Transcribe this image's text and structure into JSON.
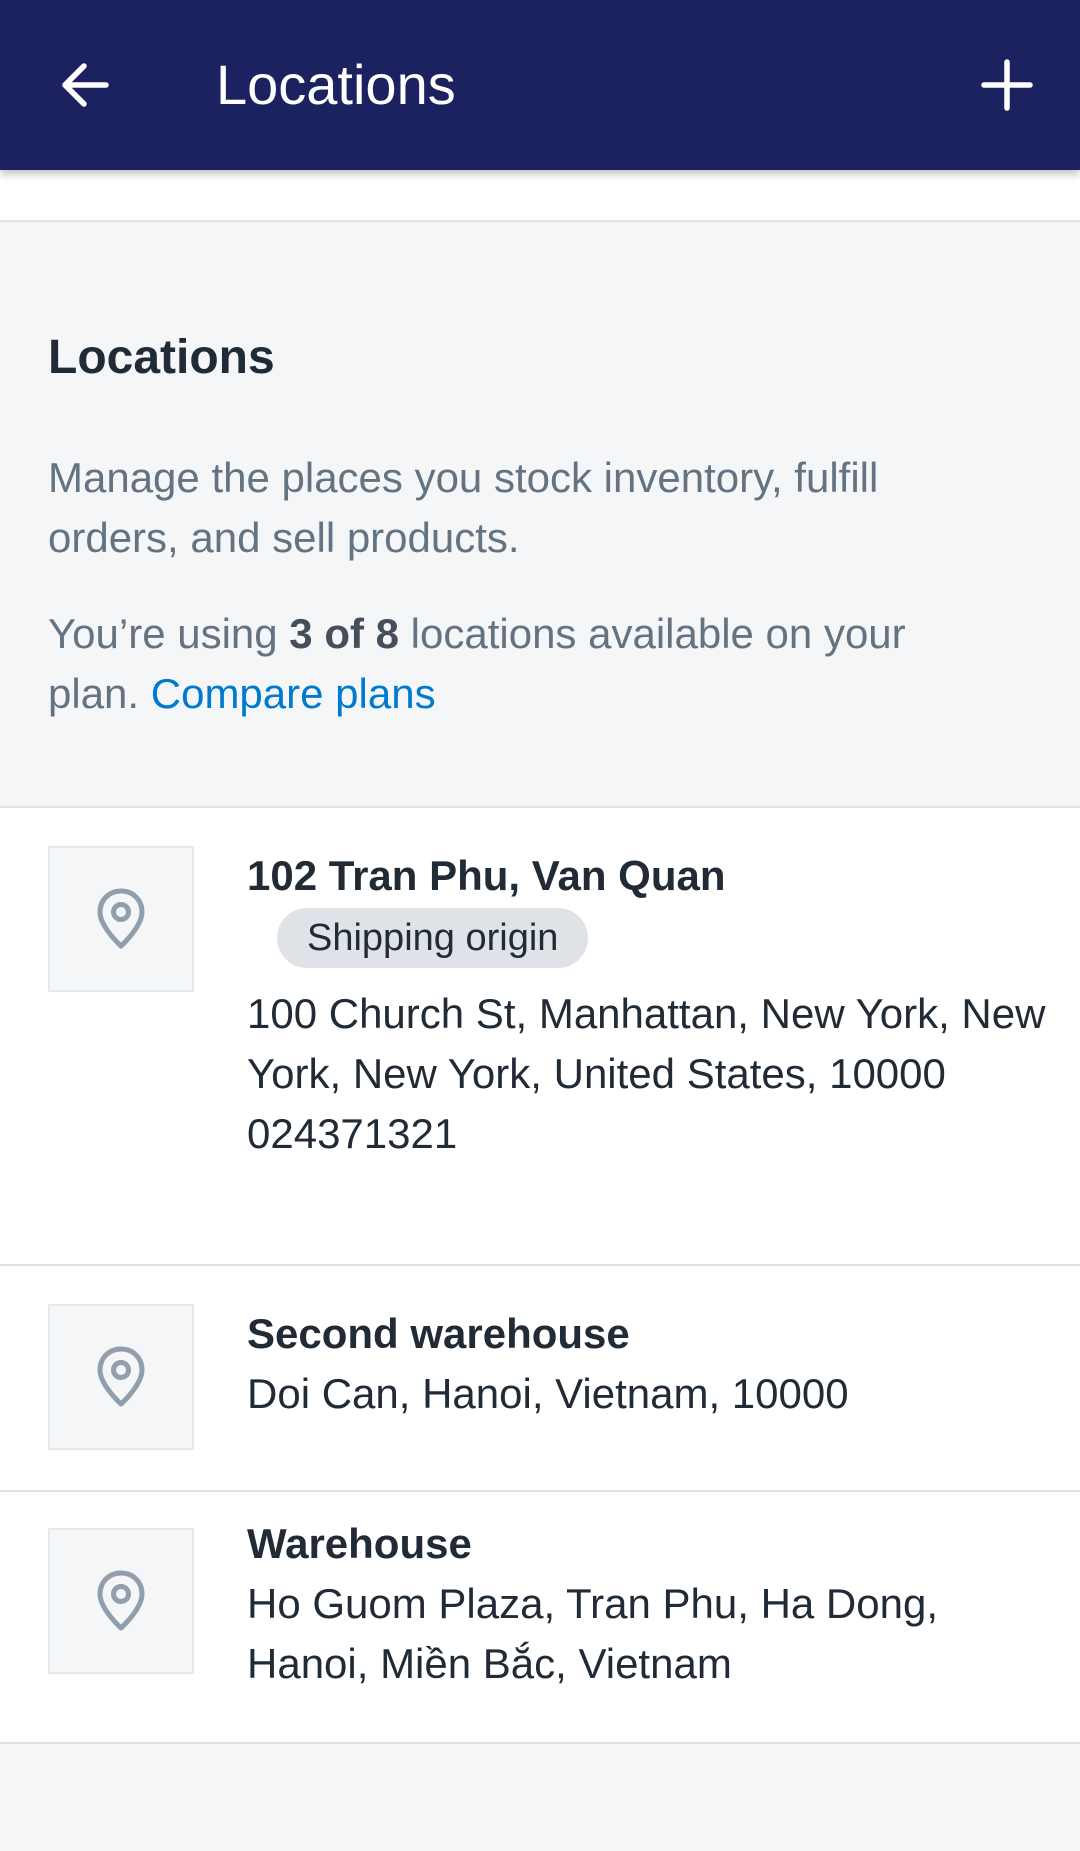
{
  "appbar": {
    "title": "Locations",
    "back_icon": "arrow-left-icon",
    "add_icon": "plus-icon",
    "background": "#1c2260"
  },
  "intro": {
    "heading": "Locations",
    "description": "Manage the places you stock inventory, fulfill orders, and sell products.",
    "usage_prefix": "You’re using ",
    "usage_count": "3 of 8",
    "usage_suffix": " locations available on your plan. ",
    "compare_link": "Compare plans",
    "link_color": "#007ace"
  },
  "locations": [
    {
      "name": "102 Tran Phu, Van Quan",
      "badge": "Shipping origin",
      "address_lines": [
        "100 Church St, Manhattan, New York, New York, New York, United States, 10000"
      ],
      "phone": "024371321",
      "icon": "map-pin-icon"
    },
    {
      "name": "Second warehouse",
      "address_lines": [
        "Doi Can, Hanoi, Vietnam, 10000"
      ],
      "icon": "map-pin-icon"
    },
    {
      "name": "Warehouse",
      "address_lines": [
        "Ho Guom Plaza, Tran Phu, Ha Dong, Hanoi, Miền Bắc, Vietnam"
      ],
      "icon": "map-pin-icon"
    }
  ]
}
